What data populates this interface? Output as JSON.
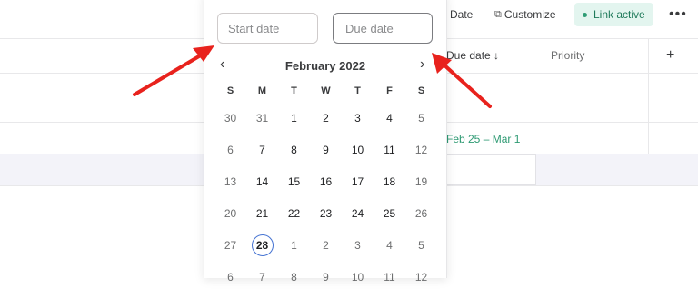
{
  "toolbar": {
    "date_label": "Date",
    "customize_label": "Customize",
    "link_label": "Link active",
    "more_label": "•••"
  },
  "table": {
    "due_header": "Due date ↓",
    "priority_header": "Priority",
    "add_column": "+",
    "row_due_value": "Feb 25 – Mar 1"
  },
  "picker": {
    "start_placeholder": "Start date",
    "due_placeholder": "Due date",
    "month_label": "February 2022",
    "prev": "‹",
    "next": "›",
    "weekdays": [
      "S",
      "M",
      "T",
      "W",
      "T",
      "F",
      "S"
    ],
    "weeks": [
      [
        {
          "d": "30",
          "m": true
        },
        {
          "d": "31",
          "m": true
        },
        {
          "d": "1"
        },
        {
          "d": "2"
        },
        {
          "d": "3"
        },
        {
          "d": "4"
        },
        {
          "d": "5",
          "m": true
        }
      ],
      [
        {
          "d": "6",
          "m": true
        },
        {
          "d": "7"
        },
        {
          "d": "8"
        },
        {
          "d": "9"
        },
        {
          "d": "10"
        },
        {
          "d": "11"
        },
        {
          "d": "12",
          "m": true
        }
      ],
      [
        {
          "d": "13",
          "m": true
        },
        {
          "d": "14"
        },
        {
          "d": "15"
        },
        {
          "d": "16"
        },
        {
          "d": "17"
        },
        {
          "d": "18"
        },
        {
          "d": "19",
          "m": true
        }
      ],
      [
        {
          "d": "20",
          "m": true
        },
        {
          "d": "21"
        },
        {
          "d": "22"
        },
        {
          "d": "23"
        },
        {
          "d": "24"
        },
        {
          "d": "25"
        },
        {
          "d": "26",
          "m": true
        }
      ],
      [
        {
          "d": "27",
          "m": true
        },
        {
          "d": "28",
          "today": true
        },
        {
          "d": "1",
          "m": true
        },
        {
          "d": "2",
          "m": true
        },
        {
          "d": "3",
          "m": true
        },
        {
          "d": "4",
          "m": true
        },
        {
          "d": "5",
          "m": true
        }
      ],
      [
        {
          "d": "6",
          "m": true
        },
        {
          "d": "7",
          "m": true
        },
        {
          "d": "8",
          "m": true
        },
        {
          "d": "9",
          "m": true
        },
        {
          "d": "10",
          "m": true
        },
        {
          "d": "11",
          "m": true
        },
        {
          "d": "12",
          "m": true
        }
      ]
    ]
  },
  "colors": {
    "arrow": "#e8221d",
    "link_bg": "#e3f5ef",
    "due_green": "#2e9a73",
    "today_ring": "#4573d2"
  }
}
